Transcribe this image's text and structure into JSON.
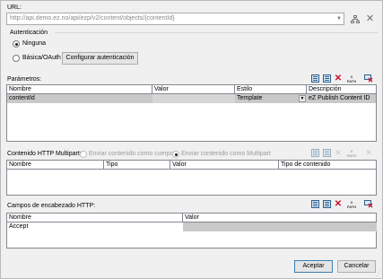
{
  "url_section": {
    "label": "URL:",
    "value": "http://api.demo.ez.no/api/ezp/v2/content/objects/{contentId}"
  },
  "auth": {
    "group_label": "Autenticación",
    "option_none": "Ninguna",
    "option_basic": "Básica/OAuth",
    "configure_button": "Configurar autenticación",
    "selected": "Ninguna"
  },
  "parameters": {
    "label": "Parámetros:",
    "columns": [
      "Nombre",
      "Valor",
      "Estilo",
      "Descripción"
    ],
    "rows": [
      {
        "nombre": "contentId",
        "valor": "",
        "estilo": "Template",
        "descripcion": "eZ Publish Content ID"
      }
    ]
  },
  "multipart": {
    "label": "Contenido HTTP Multipart:",
    "option_body": "Enviar contenido como cuerpo",
    "option_multipart": "Enviar contenido como Multipart",
    "columns": [
      "Nombre",
      "Tipo",
      "Valor",
      "Tipo de contenido"
    ]
  },
  "headers": {
    "label": "Campos de encabezado HTTP:",
    "columns": [
      "Nombre",
      "Valor"
    ],
    "rows": [
      {
        "nombre": "Accept",
        "valor": ""
      }
    ]
  },
  "footer": {
    "ok_button": "Aceptar",
    "cancel_button": "Cancelar"
  },
  "icons": {
    "url_dropdown": "chevron-down-icon",
    "url_tree": "tree-icon",
    "url_clear": "close-icon",
    "toolbar": [
      "insert-row-icon",
      "append-row-icon",
      "delete-row-icon",
      "xpath-icon",
      "remove-icon"
    ]
  },
  "colors": {
    "delete_red": "#c8102e",
    "selection_row": "#c9c9c9",
    "default_button_border": "#3c7fb1"
  }
}
